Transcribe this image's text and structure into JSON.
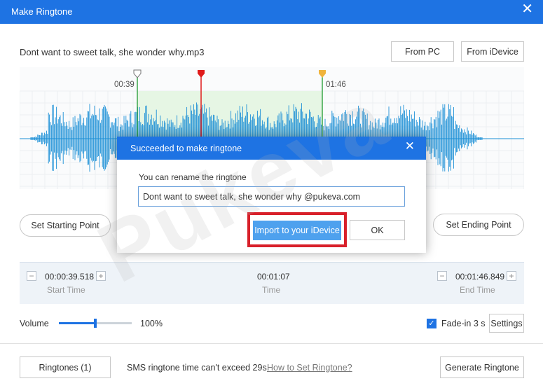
{
  "window": {
    "title": "Make Ringtone"
  },
  "file": {
    "name": "Dont want to sweet talk, she wonder why.mp3"
  },
  "buttons": {
    "from_pc": "From PC",
    "from_idevice": "From iDevice",
    "set_start": "Set Starting Point",
    "set_end": "Set Ending Point",
    "settings": "Settings",
    "ringtones": "Ringtones (1)",
    "generate": "Generate Ringtone"
  },
  "timeline": {
    "start_marker": "00:39",
    "end_marker": "01:46"
  },
  "times": {
    "start_value": "00:00:39.518",
    "start_label": "Start Time",
    "duration_value": "00:01:07",
    "duration_label": "Time",
    "end_value": "00:01:46.849",
    "end_label": "End Time",
    "minus": "−",
    "plus": "+"
  },
  "volume": {
    "label": "Volume",
    "value": "100%",
    "level": 0.5
  },
  "fade": {
    "label": "Fade-in 3 s",
    "checked": true
  },
  "footer": {
    "sms_note": "SMS ringtone time can't exceed 29s.",
    "howto_link": "How to Set Ringtone?"
  },
  "dialog": {
    "title": "Succeeded to make ringtone",
    "prompt": "You can rename the ringtone",
    "input_value": "Dont want to sweet talk, she wonder why @pukeva.com",
    "import_button": "Import to your iDevice",
    "ok_button": "OK"
  },
  "watermark": "Pukeva",
  "colors": {
    "accent": "#1e73e3",
    "wave": "#1a8fd6",
    "selection": "#e6f6e4",
    "highlight": "#d8202a",
    "playhead": "#e01b1b",
    "end_marker": "#f0b43c",
    "start_marker_line": "#3aa64a"
  }
}
